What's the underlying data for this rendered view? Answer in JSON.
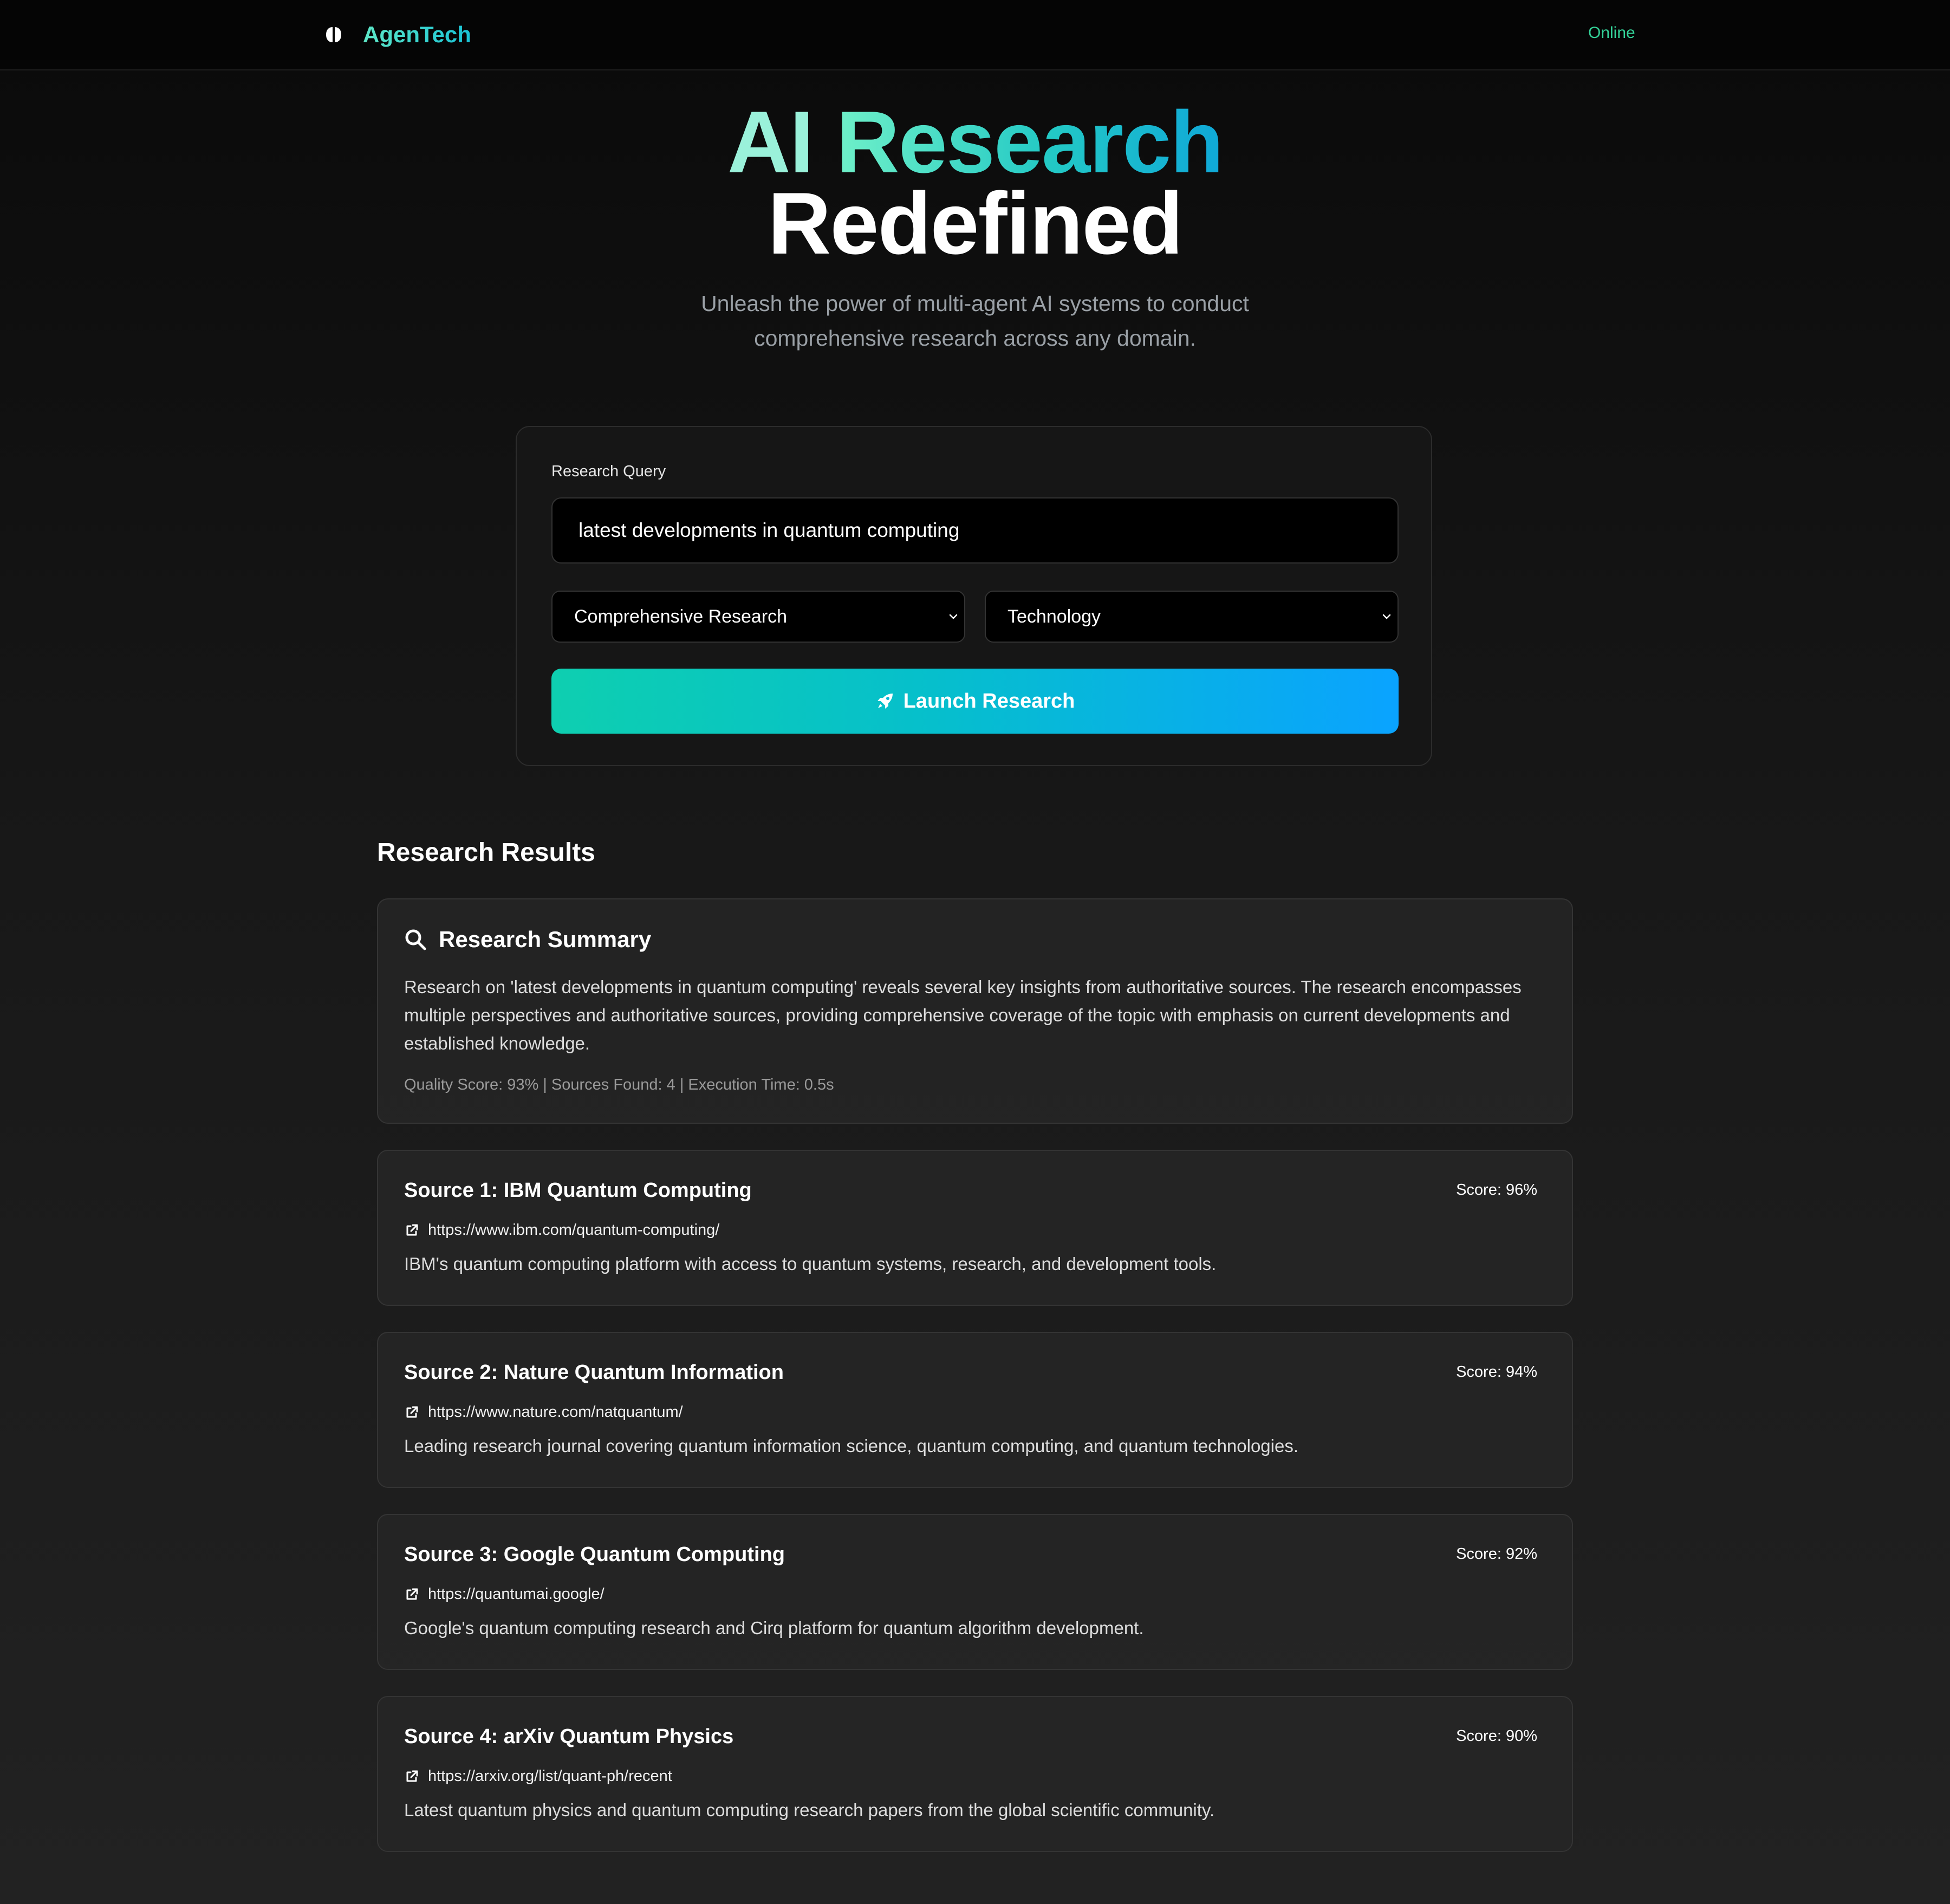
{
  "nav": {
    "brand": "AgenTech",
    "brand_icon": "brain-icon",
    "status": "Online",
    "status_color": "#34d399"
  },
  "hero": {
    "line1_a": "AI",
    "line1_b": "Research",
    "line2": "Redefined",
    "subtitle": "Unleash the power of multi-agent AI systems to conduct comprehensive research across any domain."
  },
  "query": {
    "label": "Research Query",
    "value": "latest developments in quantum computing",
    "mode_selected": "Comprehensive Research",
    "domain_selected": "Technology",
    "launch_label": "Launch Research",
    "launch_icon": "rocket-icon",
    "accent_start": "#0ecfb0",
    "accent_end": "#0aa3ff"
  },
  "results": {
    "title": "Research Results",
    "summary": {
      "title": "Research Summary",
      "icon": "search-icon",
      "text": "Research on 'latest developments in quantum computing' reveals several key insights from authoritative sources. The research encompasses multiple perspectives and authoritative sources, providing comprehensive coverage of the topic with emphasis on current developments and established knowledge.",
      "meta": "Quality Score: 93% | Sources Found: 4 | Execution Time: 0.5s"
    },
    "sources": [
      {
        "title": "Source 1: IBM Quantum Computing",
        "score": "Score: 96%",
        "url": "https://www.ibm.com/quantum-computing/",
        "desc": "IBM's quantum computing platform with access to quantum systems, research, and development tools."
      },
      {
        "title": "Source 2: Nature Quantum Information",
        "score": "Score: 94%",
        "url": "https://www.nature.com/natquantum/",
        "desc": "Leading research journal covering quantum information science, quantum computing, and quantum technologies."
      },
      {
        "title": "Source 3: Google Quantum Computing",
        "score": "Score: 92%",
        "url": "https://quantumai.google/",
        "desc": "Google's quantum computing research and Cirq platform for quantum algorithm development."
      },
      {
        "title": "Source 4: arXiv Quantum Physics",
        "score": "Score: 90%",
        "url": "https://arxiv.org/list/quant-ph/recent",
        "desc": "Latest quantum physics and quantum computing research papers from the global scientific community."
      }
    ]
  }
}
